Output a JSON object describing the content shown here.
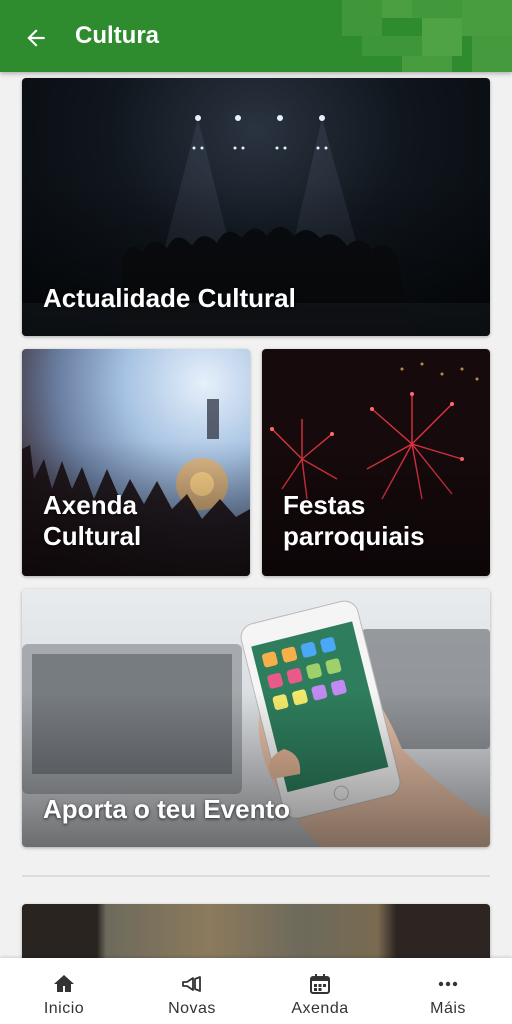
{
  "header": {
    "title": "Cultura",
    "back_icon": "arrow-left-icon",
    "color": "#2e8b2e"
  },
  "cards": [
    {
      "label": "Actualidade Cultural"
    },
    {
      "label_line1": "Axenda",
      "label_line2": "Cultural"
    },
    {
      "label_line1": "Festas",
      "label_line2": "parroquiais"
    },
    {
      "label": "Aporta o teu Evento"
    }
  ],
  "bottom_nav": {
    "items": [
      {
        "label": "Inicio",
        "icon": "home-icon"
      },
      {
        "label": "Novas",
        "icon": "megaphone-icon"
      },
      {
        "label": "Axenda",
        "icon": "calendar-icon"
      },
      {
        "label": "Máis",
        "icon": "more-icon"
      }
    ]
  }
}
